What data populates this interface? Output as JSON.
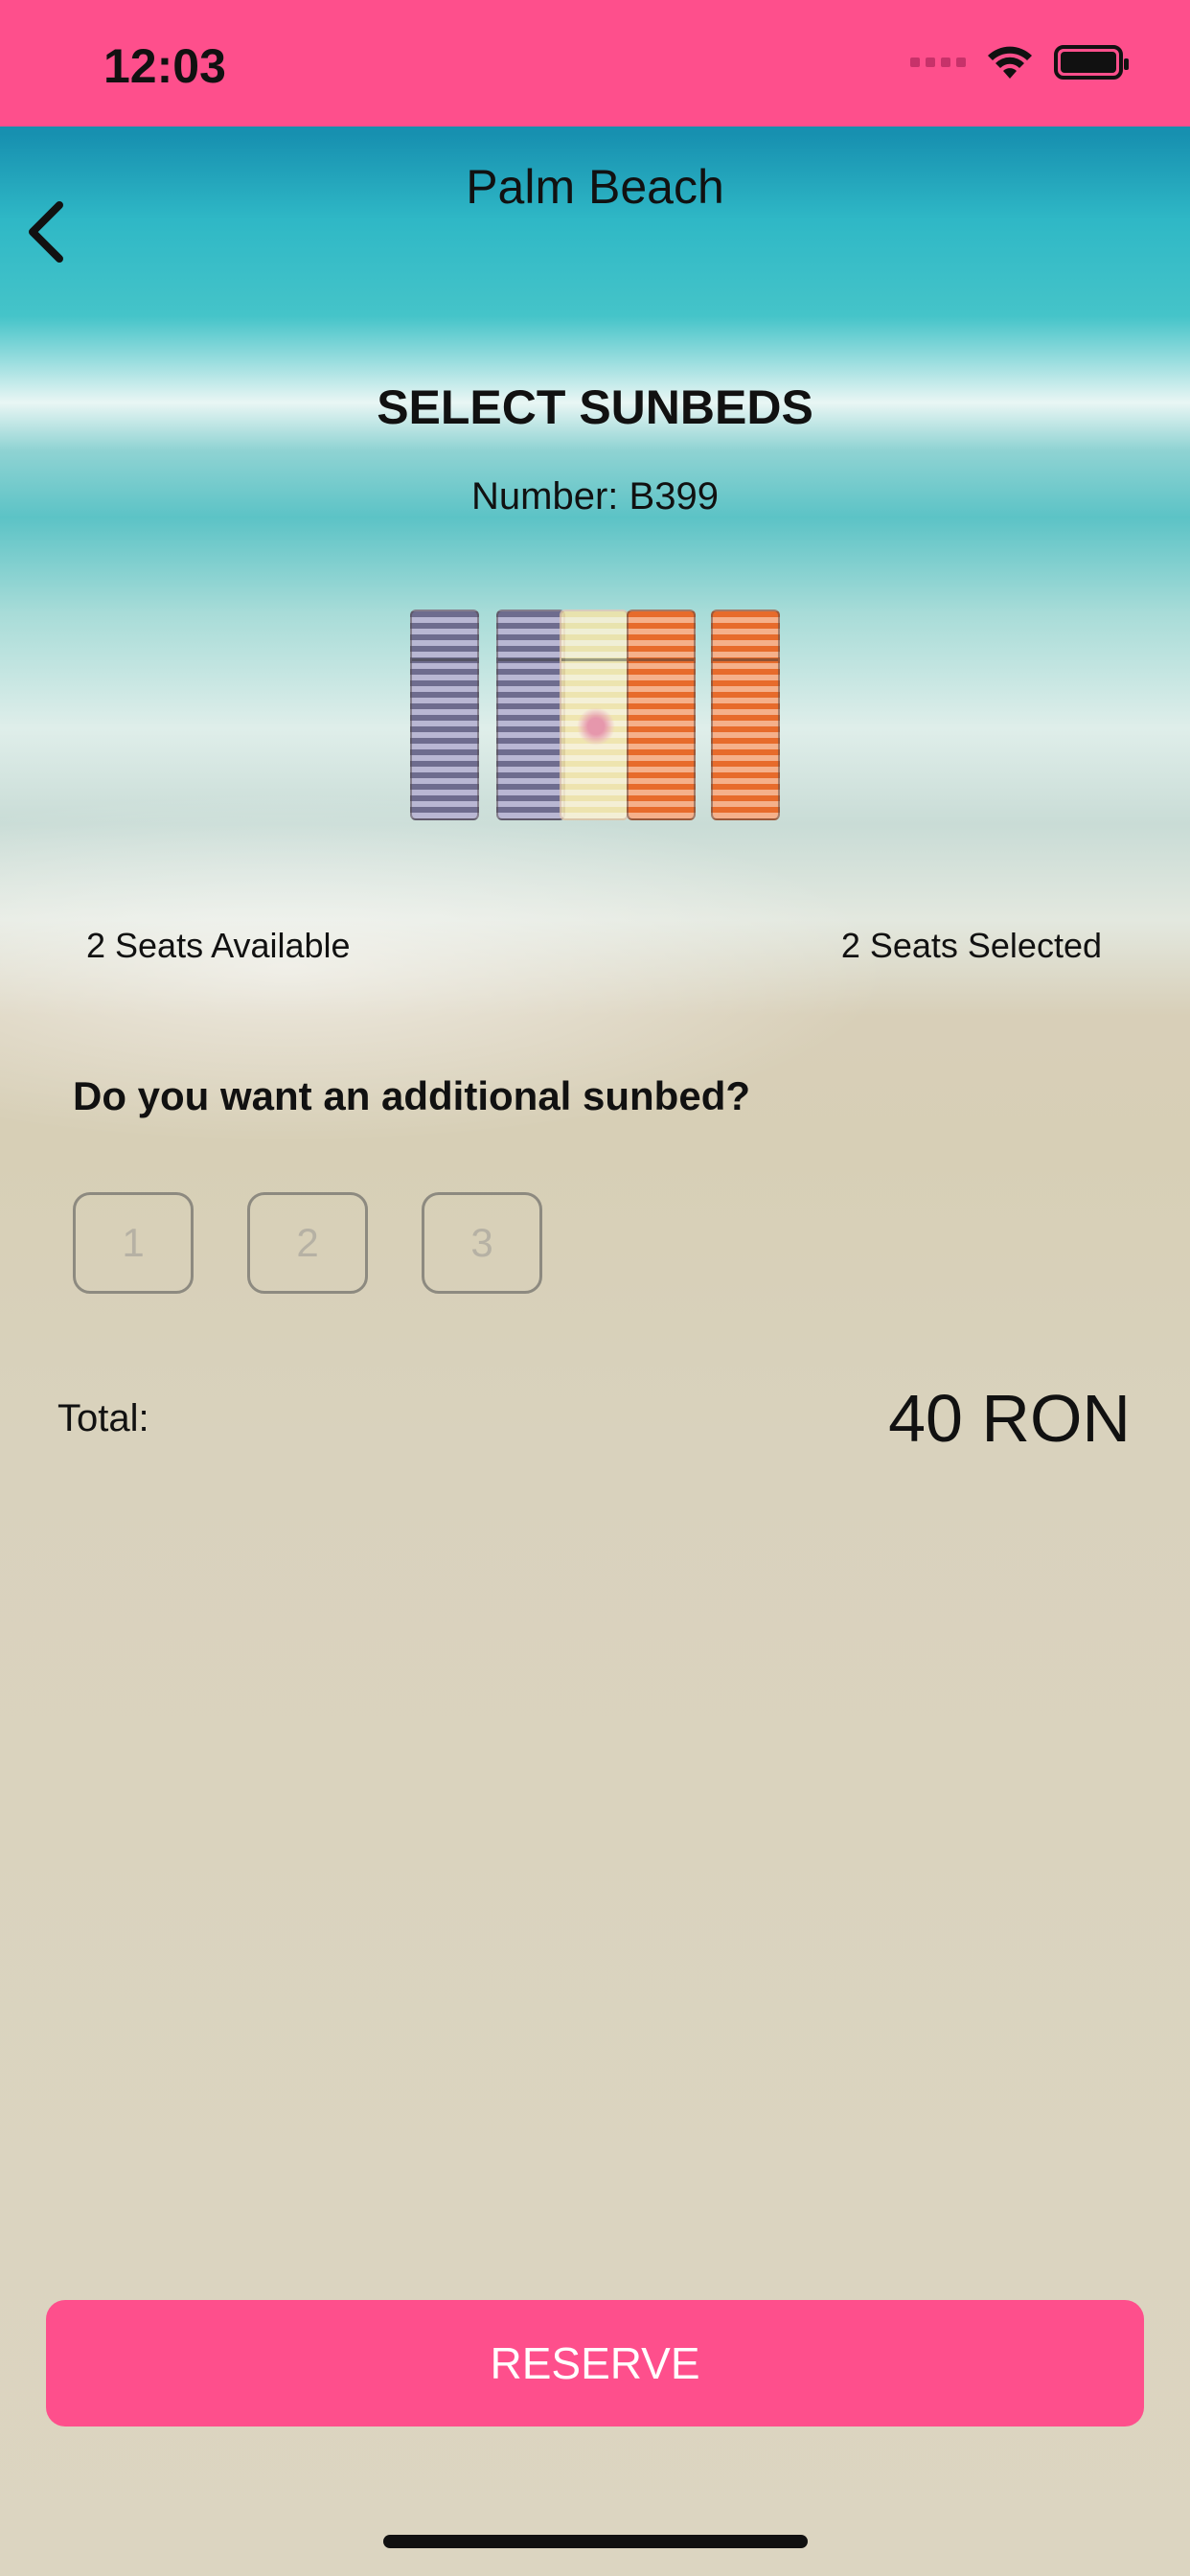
{
  "colors": {
    "accent": "#fe4f8c",
    "text": "#111111",
    "option_border": "#8d8a80"
  },
  "status_bar": {
    "time": "12:03",
    "icons": [
      "signal-dots-icon",
      "wifi-icon",
      "battery-icon"
    ]
  },
  "nav": {
    "title": "Palm Beach",
    "back_icon": "chevron-left-icon"
  },
  "main": {
    "heading": "SELECT SUNBEDS",
    "number": "Number: B399",
    "sunbeds": [
      {
        "color": "purple",
        "state": "unavailable"
      },
      {
        "color": "purple",
        "state": "unavailable"
      },
      {
        "color": "yellow",
        "state": "umbrella"
      },
      {
        "color": "orange",
        "state": "available"
      },
      {
        "color": "orange",
        "state": "available"
      }
    ],
    "seats_available": "2 Seats Available",
    "seats_selected": "2 Seats Selected",
    "question": "Do you want an additional sunbed?",
    "options": [
      "1",
      "2",
      "3"
    ],
    "total_label": "Total:",
    "total_value": "40 RON"
  },
  "footer": {
    "reserve_label": "RESERVE"
  }
}
